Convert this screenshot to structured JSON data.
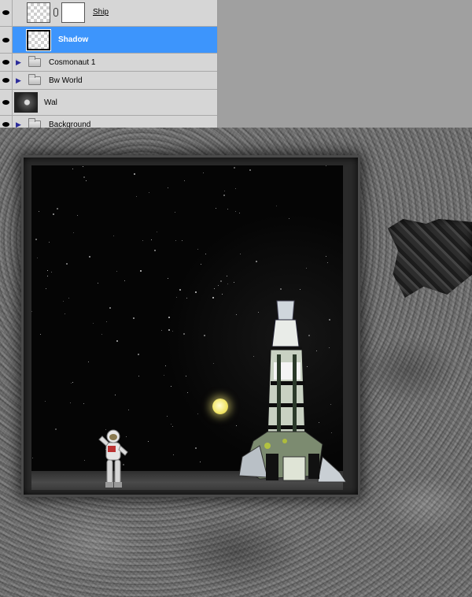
{
  "layers_panel": {
    "layers": [
      {
        "name": "Ship",
        "type": "layer-with-mask",
        "visible": true,
        "selected": false
      },
      {
        "name": "Shadow",
        "type": "layer",
        "visible": true,
        "selected": true
      },
      {
        "name": "Cosmonaut 1",
        "type": "group",
        "visible": true,
        "selected": false
      },
      {
        "name": "Bw World",
        "type": "group",
        "visible": true,
        "selected": false
      },
      {
        "name": "Wal",
        "type": "layer",
        "visible": true,
        "selected": false
      },
      {
        "name": "Background",
        "type": "group",
        "visible": true,
        "selected": false
      }
    ],
    "selected_color": "#3d95fc"
  },
  "canvas": {
    "subjects": [
      "astronaut",
      "rocket-ship",
      "moon",
      "stone-wall",
      "space-window"
    ],
    "moon_color": "#f1e567"
  }
}
